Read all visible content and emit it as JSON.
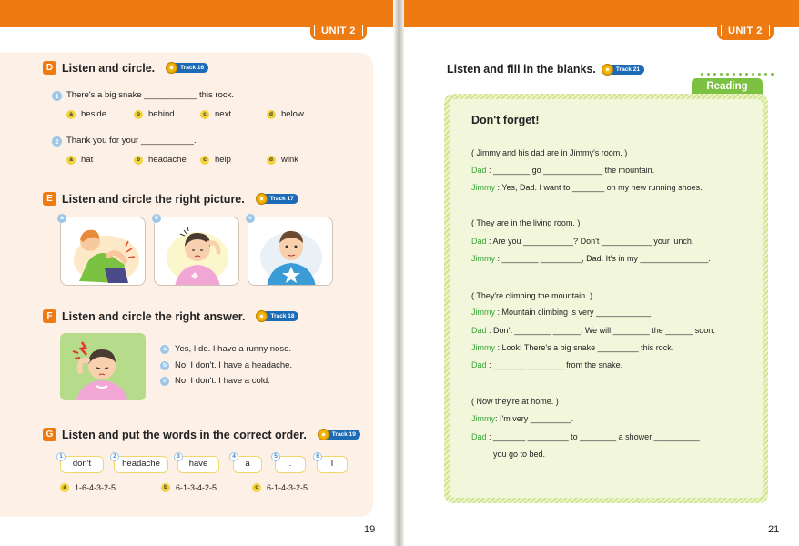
{
  "left_page": {
    "unit_tab": "UNIT 2",
    "page_number": "19",
    "sectionD": {
      "letter": "D",
      "title": "Listen and circle.",
      "track": "Track 16",
      "q1": {
        "num": "1",
        "text": "There's a big snake ___________ this rock.",
        "options": [
          {
            "badge": "a",
            "text": "beside"
          },
          {
            "badge": "b",
            "text": "behind"
          },
          {
            "badge": "c",
            "text": "next"
          },
          {
            "badge": "d",
            "text": "below"
          }
        ]
      },
      "q2": {
        "num": "2",
        "text": "Thank you for your ___________.",
        "options": [
          {
            "badge": "a",
            "text": "hat"
          },
          {
            "badge": "b",
            "text": "headache"
          },
          {
            "badge": "c",
            "text": "help"
          },
          {
            "badge": "d",
            "text": "wink"
          }
        ]
      }
    },
    "sectionE": {
      "letter": "E",
      "title": "Listen and circle the right picture.",
      "track": "Track 17",
      "pictures": [
        {
          "badge": "a"
        },
        {
          "badge": "b"
        },
        {
          "badge": "c"
        }
      ]
    },
    "sectionF": {
      "letter": "F",
      "title": "Listen and circle the right answer.",
      "track": "Track 18",
      "answers": [
        {
          "badge": "a",
          "text": "Yes, I do. I have a runny nose."
        },
        {
          "badge": "b",
          "text": "No, I don't. I have a headache."
        },
        {
          "badge": "c",
          "text": "No, I don't. I have a cold."
        }
      ]
    },
    "sectionG": {
      "letter": "G",
      "title": "Listen and put the words in the correct order.",
      "track": "Track 19",
      "words": [
        {
          "num": "1",
          "text": "don't"
        },
        {
          "num": "2",
          "text": "headache"
        },
        {
          "num": "3",
          "text": "have"
        },
        {
          "num": "4",
          "text": "a"
        },
        {
          "num": "5",
          "text": "."
        },
        {
          "num": "6",
          "text": "I"
        }
      ],
      "options": [
        {
          "badge": "a",
          "text": "1-6-4-3-2-5"
        },
        {
          "badge": "b",
          "text": "6-1-3-4-2-5"
        },
        {
          "badge": "c",
          "text": "6-1-4-3-2-5"
        }
      ]
    }
  },
  "right_page": {
    "unit_tab": "UNIT 2",
    "page_number": "21",
    "header": "Listen and fill in the blanks.",
    "track": "Track 21",
    "reading_tab": "Reading",
    "story_title": "Don't forget!",
    "lines": [
      {
        "kind": "scene",
        "text": "( Jimmy and his dad are in Jimmy's room. )"
      },
      {
        "kind": "line",
        "speaker": "Dad",
        "sep": " : ",
        "text": "________ go _____________ the mountain."
      },
      {
        "kind": "line",
        "speaker": "Jimmy",
        "sep": " : ",
        "text": "Yes, Dad. I want to _______ on my new running shoes."
      },
      {
        "kind": "scene",
        "text": "( They are in the living room. )"
      },
      {
        "kind": "line",
        "speaker": "Dad",
        "sep": " : ",
        "text": "Are you ___________? Don't ___________ your lunch."
      },
      {
        "kind": "line",
        "speaker": "Jimmy",
        "sep": " : ",
        "text": "________ _________, Dad. It's in my _______________."
      },
      {
        "kind": "scene",
        "text": "( They're climbing the mountain. )"
      },
      {
        "kind": "line",
        "speaker": "Jimmy",
        "sep": " : ",
        "text": "Mountain climbing is very ____________."
      },
      {
        "kind": "line",
        "speaker": "Dad",
        "sep": " : ",
        "text": "Don't ________ ______. We will ________ the ______ soon."
      },
      {
        "kind": "line",
        "speaker": "Jimmy",
        "sep": " : ",
        "text": "Look! There's a big snake _________ this rock."
      },
      {
        "kind": "line",
        "speaker": "Dad",
        "sep": " : ",
        "text": "_______ ________ from the snake."
      },
      {
        "kind": "scene",
        "text": "( Now they're at home. )"
      },
      {
        "kind": "line",
        "speaker": "Jimmy",
        "sep": ": ",
        "text": "I'm very _________."
      },
      {
        "kind": "line",
        "speaker": "Dad",
        "sep": " : ",
        "text": "_______ _________ to ________ a shower __________"
      },
      {
        "kind": "cont",
        "text": "you go to bed."
      }
    ]
  }
}
